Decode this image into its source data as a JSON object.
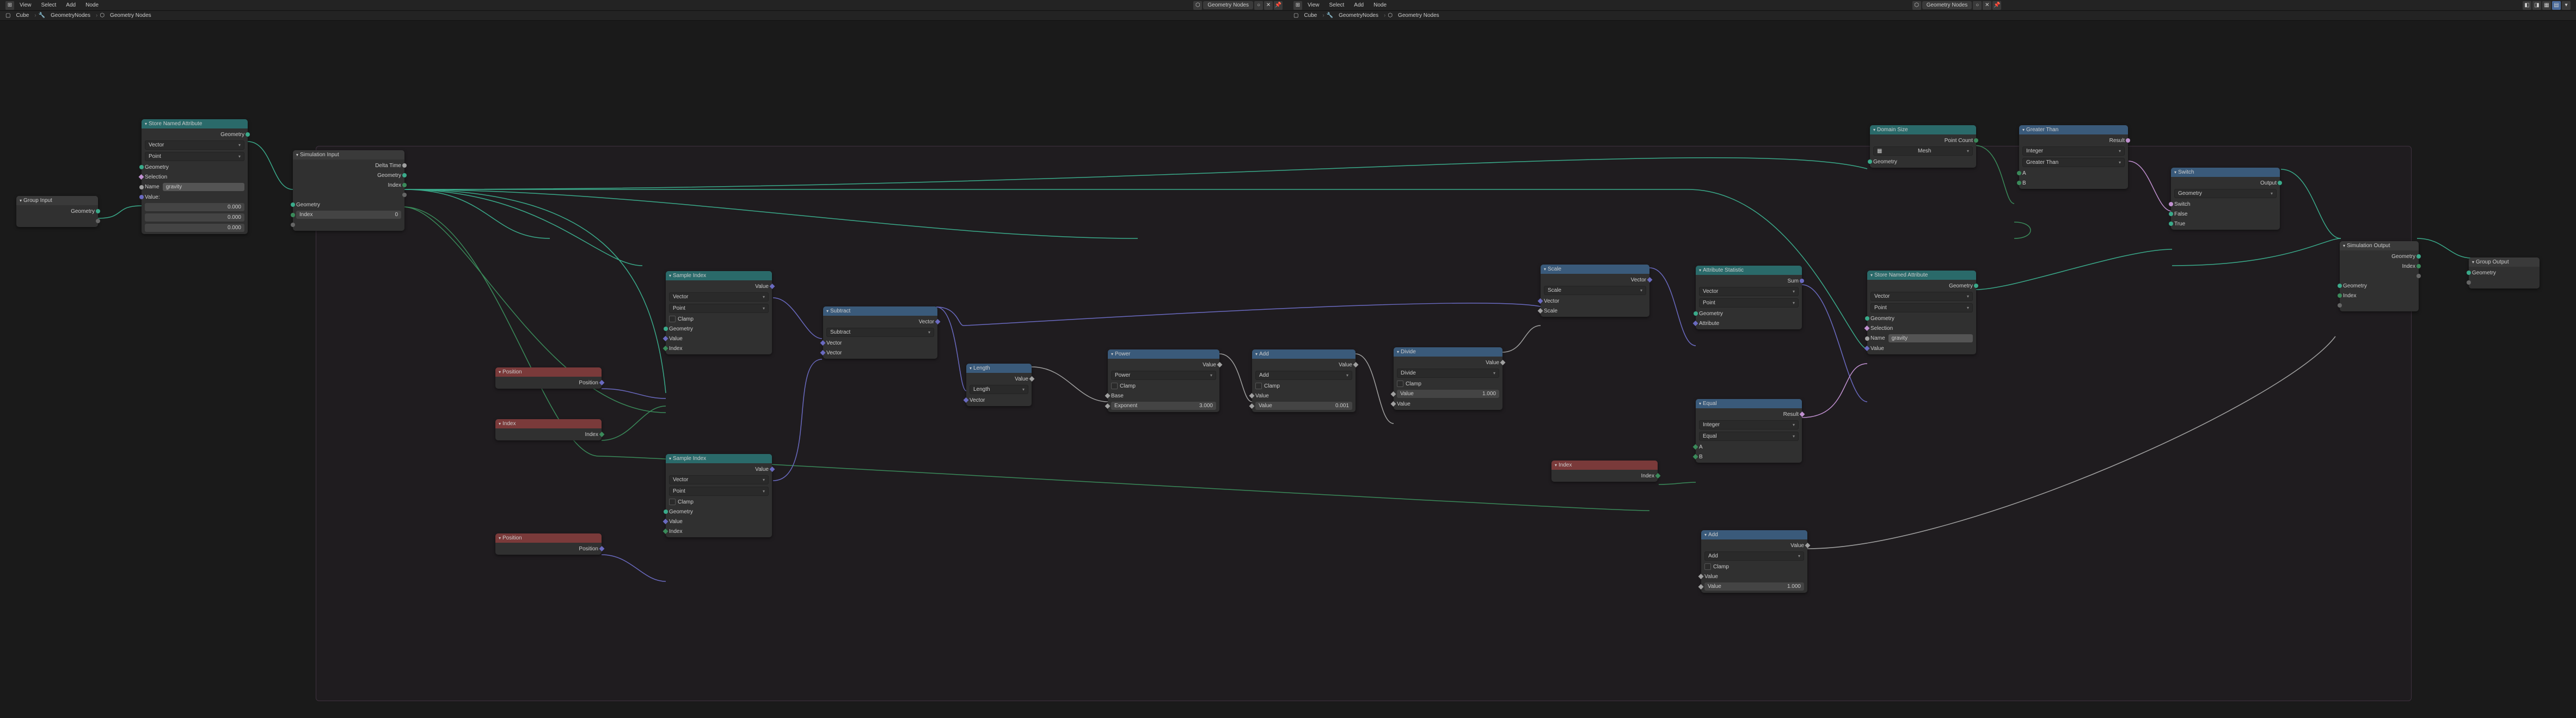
{
  "menu": {
    "view": "View",
    "select": "Select",
    "add": "Add",
    "node": "Node"
  },
  "mode": {
    "label": "Geometry Nodes"
  },
  "breadcrumb": {
    "cube": "Cube",
    "gn": "GeometryNodes",
    "gn2": "Geometry Nodes"
  },
  "nodes": {
    "group_input": {
      "title": "Group Input",
      "out0": "Geometry"
    },
    "store1": {
      "title": "Store Named Attribute",
      "out_geom": "Geometry",
      "type": "Vector",
      "domain": "Point",
      "geom": "Geometry",
      "sel": "Selection",
      "name_lbl": "Name",
      "name_val": "gravity",
      "value_lbl": "Value:",
      "vx": "0.000",
      "vy": "0.000",
      "vz": "0.000"
    },
    "sim_in": {
      "title": "Simulation Input",
      "delta": "Delta Time",
      "geom": "Geometry",
      "index": "Index",
      "geom_in": "Geometry",
      "idx_lbl": "Index",
      "idx_val": "0"
    },
    "pos1": {
      "title": "Position",
      "out": "Position"
    },
    "idx1": {
      "title": "Index",
      "out": "Index"
    },
    "pos2": {
      "title": "Position",
      "out": "Position"
    },
    "sample1": {
      "title": "Sample Index",
      "out": "Value",
      "type": "Vector",
      "domain": "Point",
      "clamp": "Clamp",
      "geom": "Geometry",
      "val": "Value",
      "idx": "Index"
    },
    "sample2": {
      "title": "Sample Index",
      "out": "Value",
      "type": "Vector",
      "domain": "Point",
      "clamp": "Clamp",
      "geom": "Geometry",
      "val": "Value",
      "idx": "Index"
    },
    "sub": {
      "title": "Subtract",
      "out": "Vector",
      "op": "Subtract",
      "v1": "Vector",
      "v2": "Vector"
    },
    "length": {
      "title": "Length",
      "out": "Value",
      "op": "Length",
      "v": "Vector"
    },
    "power": {
      "title": "Power",
      "out": "Value",
      "op": "Power",
      "clamp": "Clamp",
      "base": "Base",
      "exp_lbl": "Exponent",
      "exp_val": "3.000"
    },
    "add1": {
      "title": "Add",
      "out": "Value",
      "op": "Add",
      "clamp": "Clamp",
      "v1": "Value",
      "v2_lbl": "Value",
      "v2_val": "0.001"
    },
    "divide": {
      "title": "Divide",
      "out": "Value",
      "op": "Divide",
      "clamp": "Clamp",
      "v1_lbl": "Value",
      "v1_val": "1.000",
      "v2": "Value"
    },
    "scale": {
      "title": "Scale",
      "out": "Vector",
      "op": "Scale",
      "v": "Vector",
      "s": "Scale"
    },
    "idx2": {
      "title": "Index",
      "out": "Index"
    },
    "attrstat": {
      "title": "Attribute Statistic",
      "out": "Sum",
      "type": "Vector",
      "domain": "Point",
      "geom": "Geometry",
      "attr": "Attribute"
    },
    "equal": {
      "title": "Equal",
      "out": "Result",
      "type": "Integer",
      "op": "Equal",
      "a": "A",
      "b": "B"
    },
    "add2": {
      "title": "Add",
      "out": "Value",
      "op": "Add",
      "clamp": "Clamp",
      "v1": "Value",
      "v2_lbl": "Value",
      "v2_val": "1.000"
    },
    "domain": {
      "title": "Domain Size",
      "out": "Point Count",
      "type": "Mesh",
      "geom": "Geometry"
    },
    "store2": {
      "title": "Store Named Attribute",
      "out_geom": "Geometry",
      "type": "Vector",
      "domain": "Point",
      "geom": "Geometry",
      "sel": "Selection",
      "name_lbl": "Name",
      "name_val": "gravity",
      "val": "Value"
    },
    "greater": {
      "title": "Greater Than",
      "out": "Result",
      "type": "Integer",
      "op": "Greater Than",
      "a": "A",
      "b": "B"
    },
    "switch": {
      "title": "Switch",
      "out": "Output",
      "type": "Geometry",
      "sw": "Switch",
      "f": "False",
      "t": "True"
    },
    "sim_out": {
      "title": "Simulation Output",
      "out_geom": "Geometry",
      "out_idx": "Index",
      "geom": "Geometry",
      "idx": "Index"
    },
    "group_out": {
      "title": "Group Output",
      "geom": "Geometry"
    }
  }
}
